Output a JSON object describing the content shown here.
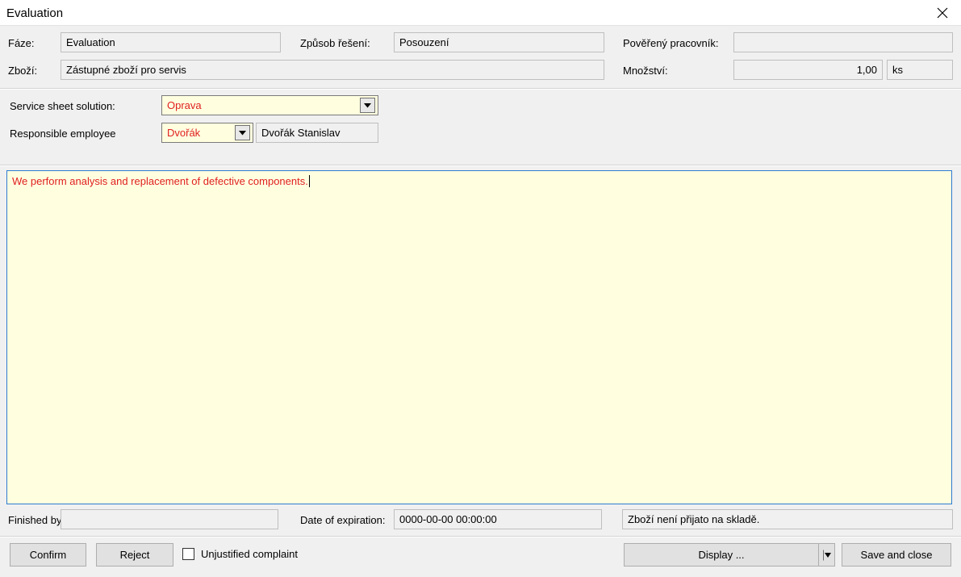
{
  "window": {
    "title": "Evaluation"
  },
  "header": {
    "faze_label": "Fáze:",
    "faze_value": "Evaluation",
    "zpusob_label": "Způsob řešení:",
    "zpusob_value": "Posouzení",
    "povereny_label": "Pověřený pracovník:",
    "povereny_value": "",
    "zbozi_label": "Zboží:",
    "zbozi_value": "Zástupné zboží pro servis",
    "mnozstvi_label": "Množství:",
    "mnozstvi_value": "1,00",
    "unit_value": "ks"
  },
  "form": {
    "solution_label": "Service sheet solution:",
    "solution_value": "Oprava",
    "employee_label": "Responsible employee",
    "employee_code": "Dvořák",
    "employee_name": "Dvořák Stanislav"
  },
  "memo": {
    "text": "We perform analysis and replacement of defective components."
  },
  "footer": {
    "finished_label": "Finished by",
    "finished_value": "",
    "expiration_label": "Date of expiration:",
    "expiration_value": "0000-00-00 00:00:00",
    "stock_status": "Zboží není přijato na skladě."
  },
  "buttons": {
    "confirm": "Confirm",
    "reject": "Reject",
    "unjustified_label": "Unjustified complaint",
    "unjustified_checked": false,
    "display": "Display ...",
    "save_close": "Save and close"
  },
  "colors": {
    "required_text": "#e02020",
    "input_bg": "#ffffe0",
    "focus_border": "#2d7bd1"
  }
}
